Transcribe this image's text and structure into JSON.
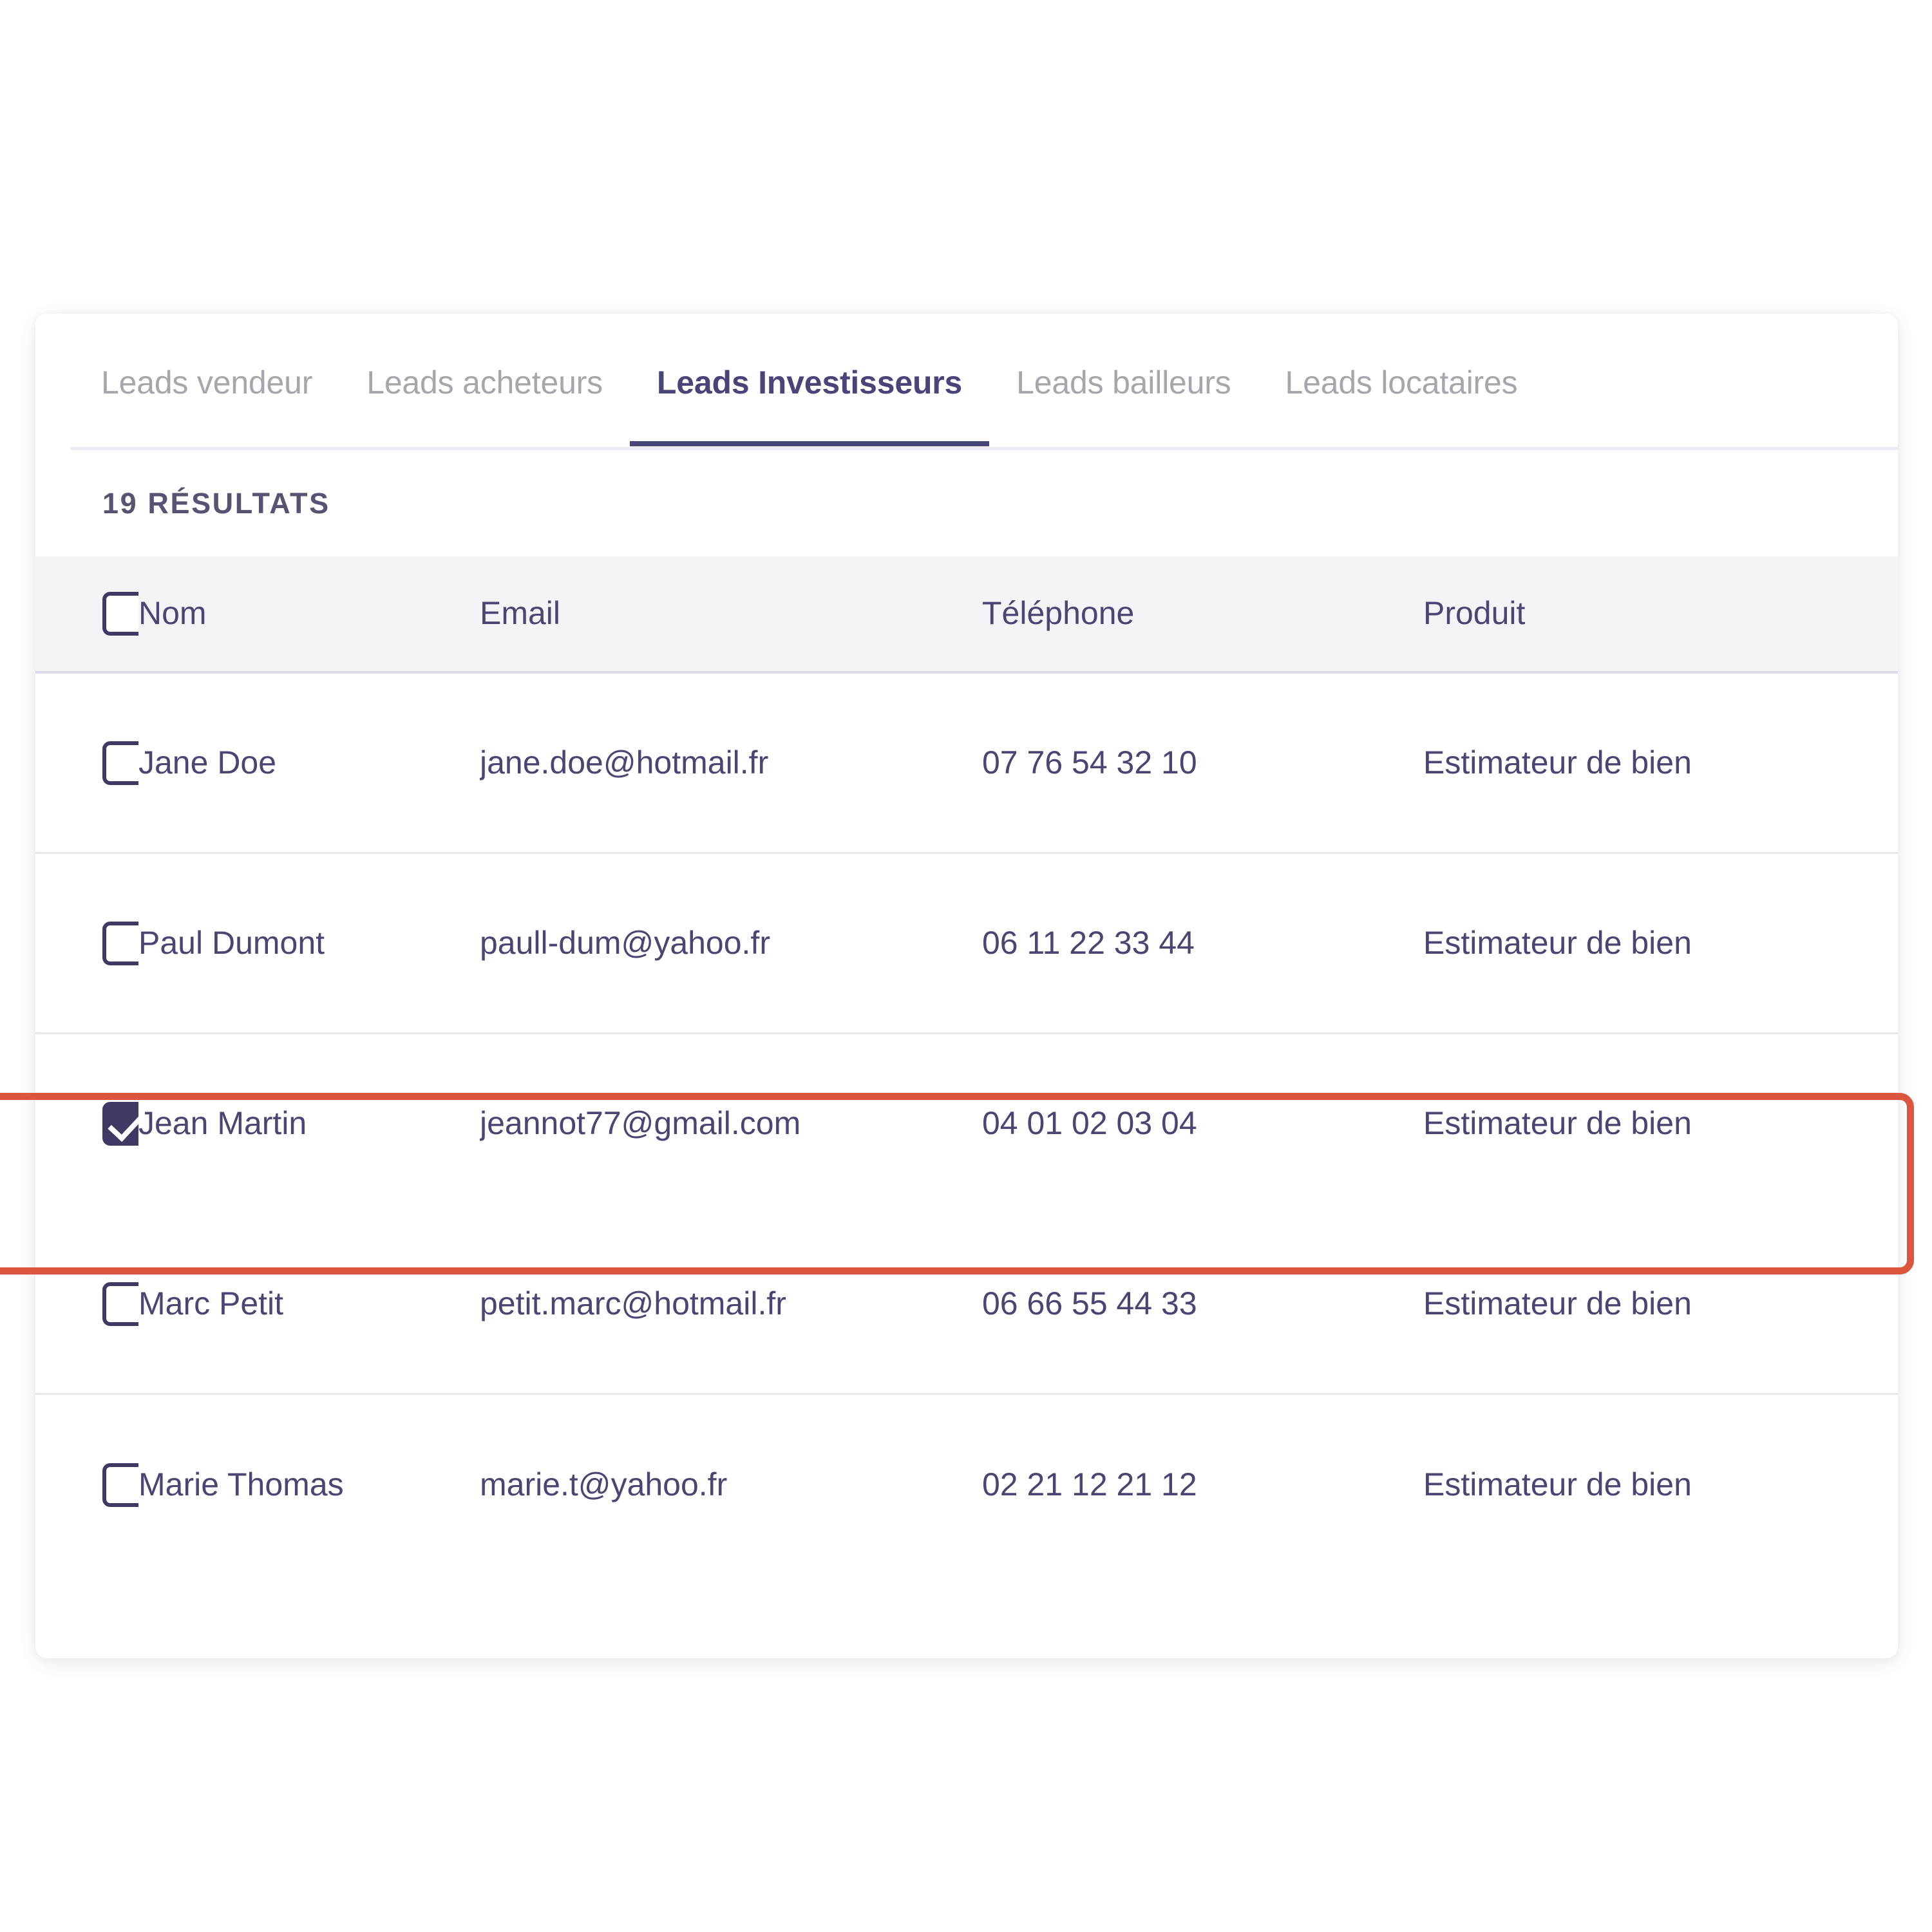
{
  "tabs": [
    {
      "label": "Leads vendeur",
      "active": false
    },
    {
      "label": "Leads acheteurs",
      "active": false
    },
    {
      "label": "Leads Investisseurs",
      "active": true
    },
    {
      "label": "Leads bailleurs",
      "active": false
    },
    {
      "label": "Leads locataires",
      "active": false
    }
  ],
  "results": {
    "count": 19,
    "label": "19 RÉSULTATS"
  },
  "table": {
    "select_all_checked": false,
    "columns": [
      "Nom",
      "Email",
      "Téléphone",
      "Produit"
    ],
    "rows": [
      {
        "selected": false,
        "nom": "Jane Doe",
        "email": "jane.doe@hotmail.fr",
        "telephone": "07 76 54 32 10",
        "produit": "Estimateur de bien",
        "highlighted": false
      },
      {
        "selected": false,
        "nom": "Paul Dumont",
        "email": "paull-dum@yahoo.fr",
        "telephone": "06 11 22 33 44",
        "produit": "Estimateur de bien",
        "highlighted": false
      },
      {
        "selected": true,
        "nom": "Jean Martin",
        "email": "jeannot77@gmail.com",
        "telephone": "04 01 02 03 04",
        "produit": "Estimateur de bien",
        "highlighted": true
      },
      {
        "selected": false,
        "nom": "Marc Petit",
        "email": "petit.marc@hotmail.fr",
        "telephone": "06 66 55 44 33",
        "produit": "Estimateur de bien",
        "highlighted": false
      },
      {
        "selected": false,
        "nom": "Marie Thomas",
        "email": "marie.t@yahoo.fr",
        "telephone": "02 21 12 21 12",
        "produit": "Estimateur de bien",
        "highlighted": false
      }
    ]
  },
  "colors": {
    "accent": "#4a4578",
    "checkbox": "#3f3a63",
    "highlight": "#dc553f",
    "text": "#4a4572",
    "muted": "#a6a6ad",
    "header_bg": "#f4f4f6",
    "divider": "#e8e6ef",
    "page_bg": "#ffffff"
  }
}
